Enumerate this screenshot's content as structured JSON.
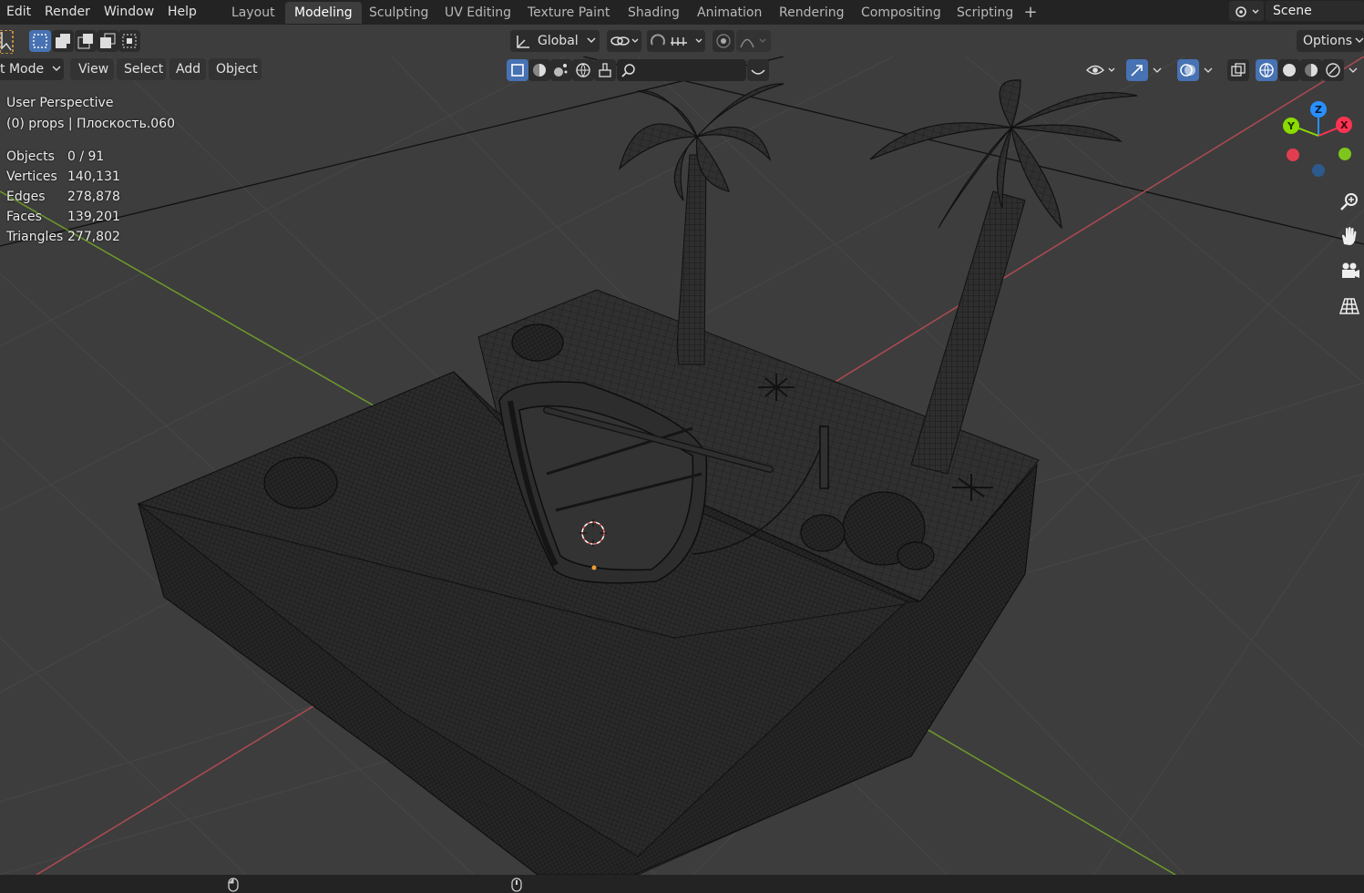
{
  "menu": {
    "edit": "Edit",
    "render": "Render",
    "window": "Window",
    "help": "Help"
  },
  "workspaces": [
    "Layout",
    "Modeling",
    "Sculpting",
    "UV Editing",
    "Texture Paint",
    "Shading",
    "Animation",
    "Rendering",
    "Compositing",
    "Scripting"
  ],
  "active_workspace": "Modeling",
  "scene": {
    "label": "Scene",
    "icon": "scene-icon"
  },
  "tool_header": {
    "transform_orientation": "Global",
    "options_label": "Options",
    "search_placeholder": ""
  },
  "viewport_header": {
    "mode_label": "t Mode",
    "view": "View",
    "select": "Select",
    "add": "Add",
    "object": "Object"
  },
  "overlay": {
    "perspective": "User Perspective",
    "collection": "(0) props | Плоскость.060",
    "stats": [
      {
        "label": "Objects",
        "value": "0 / 91"
      },
      {
        "label": "Vertices",
        "value": "140,131"
      },
      {
        "label": "Edges",
        "value": "278,878"
      },
      {
        "label": "Faces",
        "value": "139,201"
      },
      {
        "label": "Triangles",
        "value": "277,802"
      }
    ]
  },
  "gizmo": {
    "z": "Z",
    "y": "Y",
    "x": "X"
  },
  "colors": {
    "axis_x": "#ff3352",
    "axis_y": "#8bdc00",
    "axis_z": "#2890ff",
    "accent": "#4772b3",
    "viewport_bg": "#3d3d3d",
    "header_bg": "#232323"
  }
}
